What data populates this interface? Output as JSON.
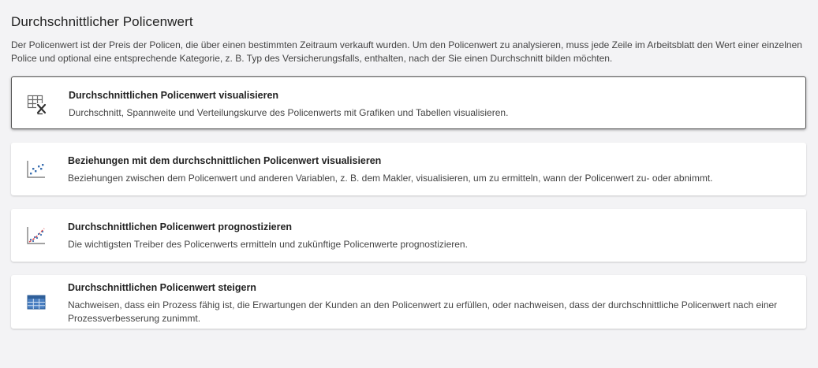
{
  "header": {
    "title": "Durchschnittlicher Policenwert",
    "description": "Der Policenwert ist der Preis der Policen, die über einen bestimmten Zeitraum verkauft wurden. Um den Policenwert zu analysieren, muss jede Zeile im Arbeitsblatt den Wert einer einzelnen Police und optional eine entsprechende Kategorie, z. B. Typ des Versicherungsfalls, enthalten, nach der Sie einen Durchschnitt bilden möchten."
  },
  "cards": [
    {
      "icon": "table-function-icon",
      "title": "Durchschnittlichen Policenwert visualisieren",
      "text": "Durchschnitt, Spannweite und Verteilungskurve des Policenwerts mit Grafiken und Tabellen visualisieren.",
      "selected": true
    },
    {
      "icon": "scatterplot-icon",
      "title": "Beziehungen mit dem durchschnittlichen Policenwert visualisieren",
      "text": "Beziehungen zwischen dem Policenwert und anderen Variablen, z. B. dem Makler, visualisieren, um zu ermitteln, wann der Policenwert zu- oder abnimmt.",
      "selected": false
    },
    {
      "icon": "regression-icon",
      "title": "Durchschnittlichen Policenwert prognostizieren",
      "text": "Die wichtigsten Treiber des Policenwerts ermitteln und zukünftige Policenwerte prognostizieren.",
      "selected": false
    },
    {
      "icon": "grid-table-icon",
      "title": "Durchschnittlichen Policenwert steigern",
      "text": "Nachweisen, dass ein Prozess fähig ist, die Erwartungen der Kunden an den Policenwert zu erfüllen, oder nachweisen, dass der durchschnittliche Policenwert nach einer Prozessverbesserung zunimmt.",
      "selected": false
    }
  ],
  "colors": {
    "background": "#f3f3f5",
    "card": "#ffffff",
    "selected_border": "#555555",
    "icon_blue": "#3a6fb0",
    "icon_red": "#d9434b",
    "icon_gray": "#6b6b6b"
  }
}
